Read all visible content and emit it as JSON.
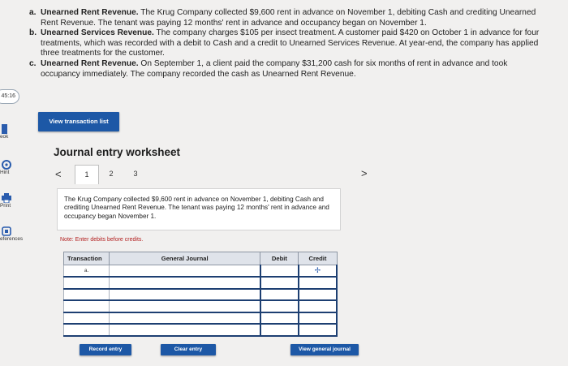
{
  "problem": {
    "items": [
      {
        "letter": "a.",
        "title": "Unearned Rent Revenue.",
        "text": " The Krug Company collected $9,600 rent in advance on November 1, debiting Cash and crediting Unearned Rent Revenue. The tenant was paying 12 months' rent in advance and occupancy began on November 1."
      },
      {
        "letter": "b.",
        "title": "Unearned Services Revenue.",
        "text": " The company charges $105 per insect treatment. A customer paid $420 on October 1 in advance for four treatments, which was recorded with a debit to Cash and a credit to Unearned Services Revenue. At year-end, the company has applied three treatments for the customer."
      },
      {
        "letter": "c.",
        "title": "Unearned Rent Revenue.",
        "text": " On September 1, a client paid the company $31,200 cash for six months of rent in advance and took occupancy immediately. The company recorded the cash as Unearned Rent Revenue."
      }
    ]
  },
  "sidebar": {
    "timer": "45:16",
    "tools": [
      {
        "label": "eok",
        "icon": "book-icon"
      },
      {
        "label": "Hint",
        "icon": "hint-icon"
      },
      {
        "label": "Print",
        "icon": "print-icon"
      },
      {
        "label": "eferences",
        "icon": "references-icon"
      }
    ]
  },
  "buttons": {
    "view_transaction_list": "View transaction list",
    "record_entry": "Record entry",
    "clear_entry": "Clear entry",
    "view_general_journal": "View general journal"
  },
  "worksheet": {
    "title": "Journal entry worksheet",
    "nav_prev": "<",
    "nav_next": ">",
    "tabs": [
      "1",
      "2",
      "3"
    ],
    "active_tab": "1",
    "description": "The Krug Company collected $9,600 rent in advance on November 1, debiting Cash and crediting Unearned Rent Revenue. The tenant was paying 12 months' rent in advance and occupancy began November 1.",
    "note": "Note: Enter debits before credits."
  },
  "journal_table": {
    "headers": [
      "Transaction",
      "General Journal",
      "Debit",
      "Credit"
    ],
    "rows": [
      {
        "transaction": "a.",
        "account": "",
        "debit": "",
        "credit": ""
      },
      {
        "transaction": "",
        "account": "",
        "debit": "",
        "credit": ""
      },
      {
        "transaction": "",
        "account": "",
        "debit": "",
        "credit": ""
      },
      {
        "transaction": "",
        "account": "",
        "debit": "",
        "credit": ""
      },
      {
        "transaction": "",
        "account": "",
        "debit": "",
        "credit": ""
      },
      {
        "transaction": "",
        "account": "",
        "debit": "",
        "credit": ""
      }
    ]
  },
  "colors": {
    "accent_blue": "#1d58a6",
    "table_border": "#1d3f72",
    "note_red": "#b32020",
    "page_bg": "#f1f0ef"
  }
}
